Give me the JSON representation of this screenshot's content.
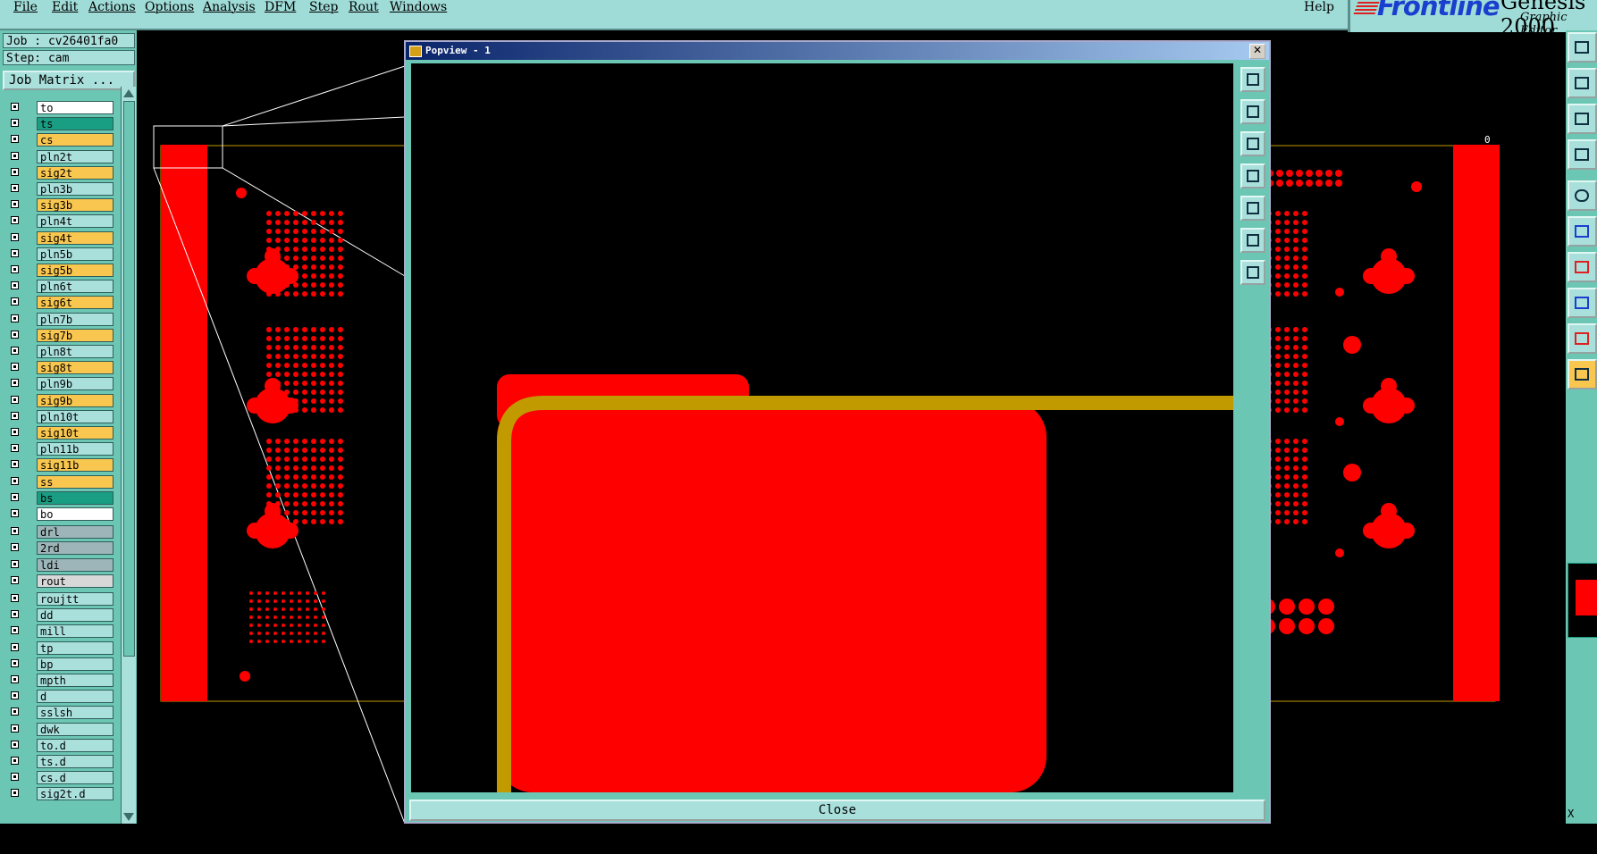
{
  "menu": {
    "items": [
      "File",
      "Edit",
      "Actions",
      "Options",
      "Analysis",
      "DFM",
      "Step",
      "Rout",
      "Windows"
    ],
    "help": "Help"
  },
  "brand": {
    "logo": "Frontline",
    "title": "Genesis 2000",
    "subtitle": "Graphic Editor"
  },
  "job": {
    "job_label": "Job : cv26401fa0",
    "step_label": "Step: cam",
    "matrix_button": "Job Matrix ..."
  },
  "layers": [
    {
      "name": "to",
      "style": "white"
    },
    {
      "name": "ts",
      "style": "teal"
    },
    {
      "name": "cs",
      "style": "board-sm"
    },
    {
      "name": "pln2t",
      "style": "board-pln"
    },
    {
      "name": "sig2t",
      "style": "board-sig"
    },
    {
      "name": "pln3b",
      "style": "board-pln"
    },
    {
      "name": "sig3b",
      "style": "board-sig"
    },
    {
      "name": "pln4t",
      "style": "board-pln"
    },
    {
      "name": "sig4t",
      "style": "board-sig"
    },
    {
      "name": "pln5b",
      "style": "board-pln"
    },
    {
      "name": "sig5b",
      "style": "board-sig"
    },
    {
      "name": "pln6t",
      "style": "board-pln"
    },
    {
      "name": "sig6t",
      "style": "board-sig"
    },
    {
      "name": "pln7b",
      "style": "board-pln"
    },
    {
      "name": "sig7b",
      "style": "board-sig"
    },
    {
      "name": "pln8t",
      "style": "board-pln"
    },
    {
      "name": "sig8t",
      "style": "board-sig"
    },
    {
      "name": "pln9b",
      "style": "board-pln"
    },
    {
      "name": "sig9b",
      "style": "board-sig"
    },
    {
      "name": "pln10t",
      "style": "board-pln"
    },
    {
      "name": "sig10t",
      "style": "board-sig"
    },
    {
      "name": "pln11b",
      "style": "board-pln"
    },
    {
      "name": "sig11b",
      "style": "board-sig"
    },
    {
      "name": "ss",
      "style": "board-sm"
    },
    {
      "name": "bs",
      "style": "teal"
    },
    {
      "name": "bo",
      "style": "white"
    },
    {
      "name": "drl",
      "style": "board-drill"
    },
    {
      "name": "2rd",
      "style": "board-drill"
    },
    {
      "name": "ldi",
      "style": "board-drill"
    },
    {
      "name": "rout",
      "style": "grey"
    },
    {
      "name": "roujtt",
      "style": "misc"
    },
    {
      "name": "dd",
      "style": "misc"
    },
    {
      "name": "mill",
      "style": "misc"
    },
    {
      "name": "tp",
      "style": "misc"
    },
    {
      "name": "bp",
      "style": "misc"
    },
    {
      "name": "mpth",
      "style": "misc"
    },
    {
      "name": "d",
      "style": "misc"
    },
    {
      "name": "sslsh",
      "style": "misc"
    },
    {
      "name": "dwk",
      "style": "misc"
    },
    {
      "name": "to.d",
      "style": "misc"
    },
    {
      "name": "ts.d",
      "style": "misc"
    },
    {
      "name": "cs.d",
      "style": "misc"
    },
    {
      "name": "sig2t.d",
      "style": "misc"
    }
  ],
  "popview": {
    "title": "Popview - 1",
    "close_button": "Close"
  },
  "colors": {
    "copper": "#ff0000",
    "profile": "#c19a00",
    "panel": "#6cc6b4",
    "field": "#a9e0dc",
    "signal_layer": "#f9c74f"
  },
  "coord_readout": "X"
}
